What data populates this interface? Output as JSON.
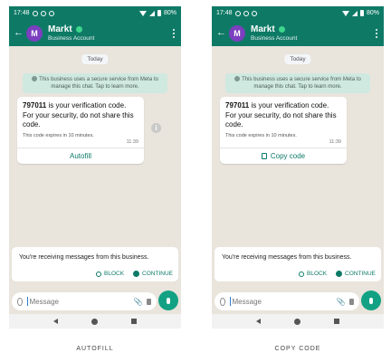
{
  "screens": [
    {
      "status": {
        "time": "17:48",
        "battery": "80%"
      },
      "contact": {
        "initial": "M",
        "name": "Markt",
        "subtitle": "Business Account"
      },
      "date_divider": "Today",
      "system_notice": "This business uses a secure service from Meta to manage this chat. Tap to learn more.",
      "message": {
        "code": "797011",
        "text": " is your verification code. For your security, do not share this code.",
        "expiry": "This code expires in 10 minutes.",
        "time": "11:39",
        "action_label": "Autofill",
        "action_icon": ""
      },
      "business_notice": {
        "text": "You're receiving messages from this business.",
        "block_label": "BLOCK",
        "continue_label": "CONTINUE"
      },
      "composer": {
        "placeholder": "Message"
      },
      "caption": "AUTOFILL"
    },
    {
      "status": {
        "time": "17:48",
        "battery": "80%"
      },
      "contact": {
        "initial": "M",
        "name": "Markt",
        "subtitle": "Business Account"
      },
      "date_divider": "Today",
      "system_notice": "This business uses a secure service from Meta to manage this chat. Tap to learn more.",
      "message": {
        "code": "797011",
        "text": " is your verification code. For your security, do not share this code.",
        "expiry": "This code expires in 10 minutes.",
        "time": "11:39",
        "action_label": "Copy code",
        "action_icon": "copy-icon"
      },
      "business_notice": {
        "text": "You're receiving messages from this business.",
        "block_label": "BLOCK",
        "continue_label": "CONTINUE"
      },
      "composer": {
        "placeholder": "Message"
      },
      "caption": "COPY CODE"
    }
  ],
  "colors": {
    "header": "#0e7a66",
    "accent": "#0d7a68",
    "mic": "#12a183",
    "chat_bg": "#e9e4dc"
  }
}
